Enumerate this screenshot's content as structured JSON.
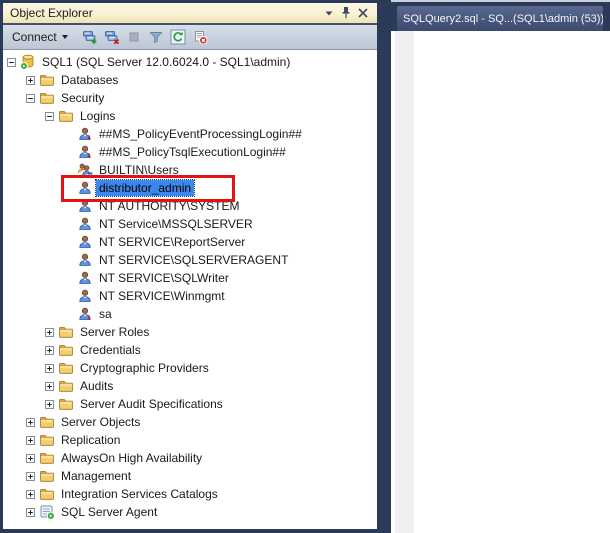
{
  "object_explorer": {
    "title": "Object Explorer",
    "titlebar_buttons": [
      {
        "name": "window-position",
        "icon": "chevron-down"
      },
      {
        "name": "pin",
        "icon": "pin"
      },
      {
        "name": "close",
        "icon": "close"
      }
    ],
    "toolbar": {
      "connect_label": "Connect",
      "buttons": [
        {
          "name": "connect-object-explorer",
          "icon": "connect-server"
        },
        {
          "name": "disconnect",
          "icon": "disconnect-server"
        },
        {
          "name": "stop",
          "icon": "stop-square"
        },
        {
          "name": "filter",
          "icon": "filter-funnel"
        },
        {
          "name": "refresh",
          "icon": "refresh"
        },
        {
          "name": "stop-script",
          "icon": "script-blocked"
        }
      ]
    },
    "tree": [
      {
        "level": 0,
        "expander": "minus",
        "icon": "server",
        "label": "SQL1 (SQL Server 12.0.6024.0 - SQL1\\admin)"
      },
      {
        "level": 1,
        "expander": "plus",
        "icon": "folder",
        "label": "Databases"
      },
      {
        "level": 1,
        "expander": "minus",
        "icon": "folder",
        "label": "Security"
      },
      {
        "level": 2,
        "expander": "minus",
        "icon": "folder",
        "label": "Logins"
      },
      {
        "level": 3,
        "expander": null,
        "icon": "user-disabled",
        "label": "##MS_PolicyEventProcessingLogin##"
      },
      {
        "level": 3,
        "expander": null,
        "icon": "user-disabled",
        "label": "##MS_PolicyTsqlExecutionLogin##"
      },
      {
        "level": 3,
        "expander": null,
        "icon": "users-group",
        "label": "BUILTIN\\Users"
      },
      {
        "level": 3,
        "expander": null,
        "icon": "user",
        "label": "distributor_admin",
        "selected": true,
        "annotated": true
      },
      {
        "level": 3,
        "expander": null,
        "icon": "user",
        "label": "NT AUTHORITY\\SYSTEM"
      },
      {
        "level": 3,
        "expander": null,
        "icon": "user",
        "label": "NT Service\\MSSQLSERVER"
      },
      {
        "level": 3,
        "expander": null,
        "icon": "user",
        "label": "NT SERVICE\\ReportServer"
      },
      {
        "level": 3,
        "expander": null,
        "icon": "user",
        "label": "NT SERVICE\\SQLSERVERAGENT"
      },
      {
        "level": 3,
        "expander": null,
        "icon": "user",
        "label": "NT SERVICE\\SQLWriter"
      },
      {
        "level": 3,
        "expander": null,
        "icon": "user",
        "label": "NT SERVICE\\Winmgmt"
      },
      {
        "level": 3,
        "expander": null,
        "icon": "user-disabled",
        "label": "sa"
      },
      {
        "level": 2,
        "expander": "plus",
        "icon": "folder",
        "label": "Server Roles"
      },
      {
        "level": 2,
        "expander": "plus",
        "icon": "folder",
        "label": "Credentials"
      },
      {
        "level": 2,
        "expander": "plus",
        "icon": "folder",
        "label": "Cryptographic Providers"
      },
      {
        "level": 2,
        "expander": "plus",
        "icon": "folder",
        "label": "Audits"
      },
      {
        "level": 2,
        "expander": "plus",
        "icon": "folder",
        "label": "Server Audit Specifications"
      },
      {
        "level": 1,
        "expander": "plus",
        "icon": "folder",
        "label": "Server Objects"
      },
      {
        "level": 1,
        "expander": "plus",
        "icon": "folder",
        "label": "Replication"
      },
      {
        "level": 1,
        "expander": "plus",
        "icon": "folder",
        "label": "AlwaysOn High Availability"
      },
      {
        "level": 1,
        "expander": "plus",
        "icon": "folder",
        "label": "Management"
      },
      {
        "level": 1,
        "expander": "plus",
        "icon": "folder",
        "label": "Integration Services Catalogs"
      },
      {
        "level": 1,
        "expander": "plus",
        "icon": "agent",
        "label": "SQL Server Agent"
      }
    ]
  },
  "document_well": {
    "tab_label": "SQLQuery2.sql - SQ...(SQL1\\admin (53))"
  },
  "colors": {
    "frame_navy": "#2B3A59",
    "titlebar_cream": "#FBF4DB",
    "toolbar_blue_gray": "#C8D1DE",
    "selection_blue": "#3B87EC",
    "annotation_red": "#E51212",
    "tab_slate": "#47567A"
  }
}
